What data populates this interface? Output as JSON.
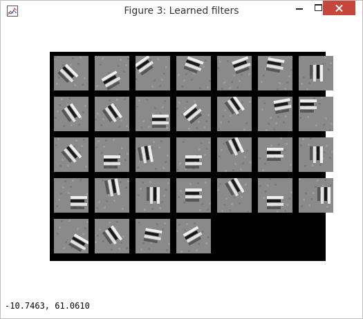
{
  "window": {
    "title": "Figure 3: Learned filters"
  },
  "status": {
    "coordinates": "-10.7463,  61.0610"
  },
  "figure": {
    "filters": [
      {
        "id": 1,
        "angle": 45,
        "pos": "center-left"
      },
      {
        "id": 2,
        "angle": -30,
        "pos": "bottom"
      },
      {
        "id": 3,
        "angle": -35,
        "pos": "top-left"
      },
      {
        "id": 4,
        "angle": 20,
        "pos": "top"
      },
      {
        "id": 5,
        "angle": -20,
        "pos": "top-right"
      },
      {
        "id": 6,
        "angle": 10,
        "pos": "top"
      },
      {
        "id": 7,
        "angle": 90,
        "pos": "center"
      },
      {
        "id": 8,
        "angle": 55,
        "pos": "center"
      },
      {
        "id": 9,
        "angle": 55,
        "pos": "center"
      },
      {
        "id": 10,
        "angle": 0,
        "pos": "bottom-right"
      },
      {
        "id": 11,
        "angle": -40,
        "pos": "center"
      },
      {
        "id": 12,
        "angle": 55,
        "pos": "top"
      },
      {
        "id": 13,
        "angle": -10,
        "pos": "top-right"
      },
      {
        "id": 14,
        "angle": 0,
        "pos": "top-left"
      },
      {
        "id": 15,
        "angle": 50,
        "pos": "center"
      },
      {
        "id": 16,
        "angle": 0,
        "pos": "bottom"
      },
      {
        "id": 17,
        "angle": 80,
        "pos": "left"
      },
      {
        "id": 18,
        "angle": 0,
        "pos": "bottom"
      },
      {
        "id": 19,
        "angle": 65,
        "pos": "top"
      },
      {
        "id": 20,
        "angle": 0,
        "pos": "center"
      },
      {
        "id": 21,
        "angle": 90,
        "pos": "center"
      },
      {
        "id": 22,
        "angle": 0,
        "pos": "bottom-right"
      },
      {
        "id": 23,
        "angle": 80,
        "pos": "top"
      },
      {
        "id": 24,
        "angle": 90,
        "pos": "center"
      },
      {
        "id": 25,
        "angle": 0,
        "pos": "center"
      },
      {
        "id": 26,
        "angle": 60,
        "pos": "top"
      },
      {
        "id": 27,
        "angle": 0,
        "pos": "bottom"
      },
      {
        "id": 28,
        "angle": 90,
        "pos": "right"
      },
      {
        "id": 29,
        "angle": 30,
        "pos": "bottom-right"
      },
      {
        "id": 30,
        "angle": 55,
        "pos": "center"
      },
      {
        "id": 31,
        "angle": 10,
        "pos": "center"
      },
      {
        "id": 32,
        "angle": -30,
        "pos": "center"
      }
    ]
  }
}
